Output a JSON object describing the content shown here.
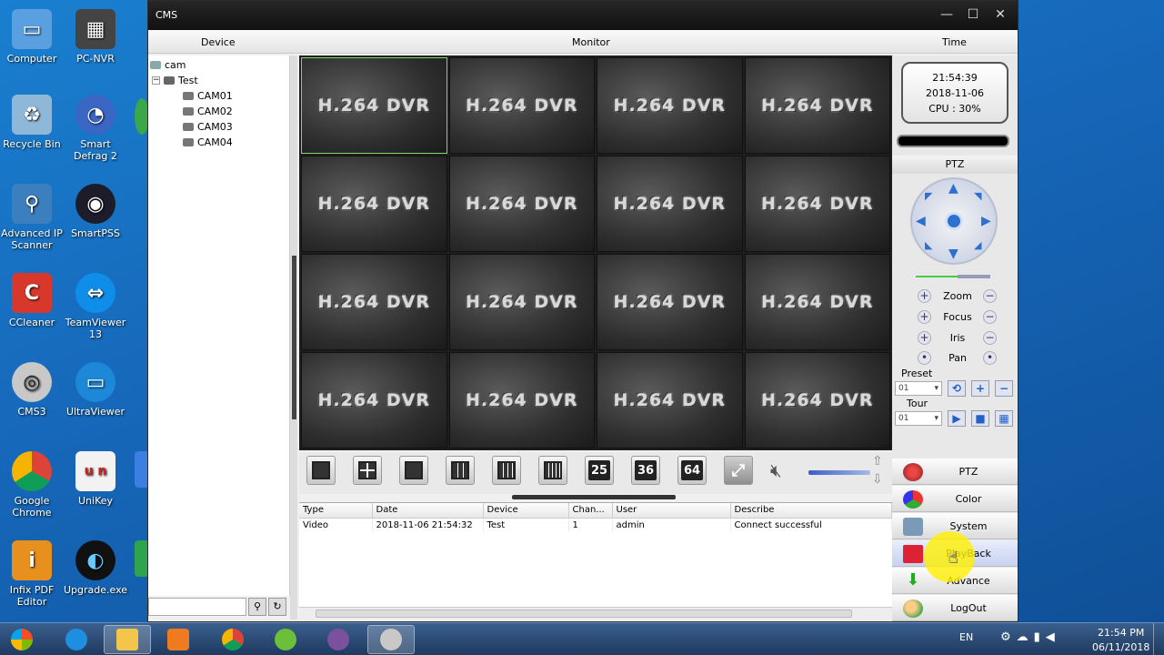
{
  "desktop": {
    "icons": [
      {
        "label": "Computer"
      },
      {
        "label": "PC-NVR"
      },
      {
        "label": "Recycle Bin"
      },
      {
        "label": "Smart Defrag 2"
      },
      {
        "label": "Advanced IP Scanner"
      },
      {
        "label": "SmartPSS"
      },
      {
        "label": "CCleaner"
      },
      {
        "label": "TeamViewer 13"
      },
      {
        "label": "CMS3"
      },
      {
        "label": "UltraViewer"
      },
      {
        "label": "Google Chrome"
      },
      {
        "label": "UniKey"
      },
      {
        "label": "Infix PDF Editor"
      },
      {
        "label": "Upgrade.exe"
      }
    ]
  },
  "window": {
    "title": "CMS",
    "columns": {
      "device": "Device",
      "monitor": "Monitor",
      "time": "Time"
    }
  },
  "tree": {
    "root": "cam",
    "group": "Test",
    "cameras": [
      "CAM01",
      "CAM02",
      "CAM03",
      "CAM04"
    ]
  },
  "grid": {
    "cell_label": "H.264 DVR",
    "cells": 16,
    "selected_cell": 1
  },
  "layout_toolbar": {
    "counts": [
      "25",
      "36",
      "64"
    ]
  },
  "log": {
    "headers": [
      "Type",
      "Date",
      "Device",
      "Chan...",
      "User",
      "Describe"
    ],
    "rows": [
      {
        "type": "Video",
        "date": "2018-11-06 21:54:32",
        "device": "Test",
        "channel": "1",
        "user": "admin",
        "describe": "Connect successful"
      }
    ]
  },
  "clock": {
    "time": "21:54:39",
    "date": "2018-11-06",
    "cpu": "CPU : 30%"
  },
  "ptz": {
    "title": "PTZ",
    "rows": [
      "Zoom",
      "Focus",
      "Iris",
      "Pan"
    ],
    "preset_label": "Preset",
    "preset_value": "01",
    "tour_label": "Tour",
    "tour_value": "01"
  },
  "menu": {
    "items": [
      "PTZ",
      "Color",
      "System",
      "PlayBack",
      "Advance",
      "LogOut"
    ]
  },
  "taskbar": {
    "lang": "EN",
    "time": "21:54 PM",
    "date": "06/11/2018"
  },
  "colors": {
    "accent_blue": "#2f6fd0",
    "selected_cell_border": "#7fd66a"
  }
}
